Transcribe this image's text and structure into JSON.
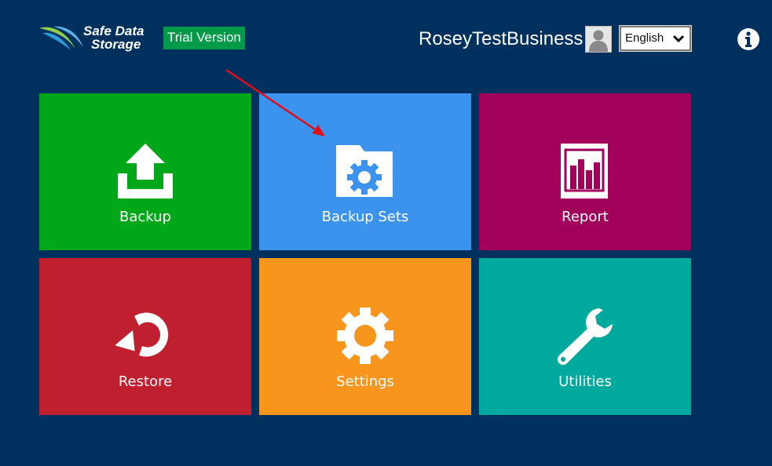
{
  "header": {
    "logo_line1": "Safe Data",
    "logo_line2": "Storage",
    "trial_badge": "Trial Version",
    "username": "RoseyTestBusiness",
    "language": "English"
  },
  "tiles": [
    {
      "label": "Backup",
      "color": "#00a819",
      "icon": "upload-icon"
    },
    {
      "label": "Backup Sets",
      "color": "#3b93ee",
      "icon": "folder-gear-icon"
    },
    {
      "label": "Report",
      "color": "#a1005b",
      "icon": "bar-chart-icon"
    },
    {
      "label": "Restore",
      "color": "#c01f30",
      "icon": "restore-icon"
    },
    {
      "label": "Settings",
      "color": "#f7951d",
      "icon": "gear-icon"
    },
    {
      "label": "Utilities",
      "color": "#00a99d",
      "icon": "wrench-icon"
    }
  ],
  "colors": {
    "background": "#00305e",
    "trial_badge": "#009a49",
    "annotation_arrow": "#e0101a"
  }
}
